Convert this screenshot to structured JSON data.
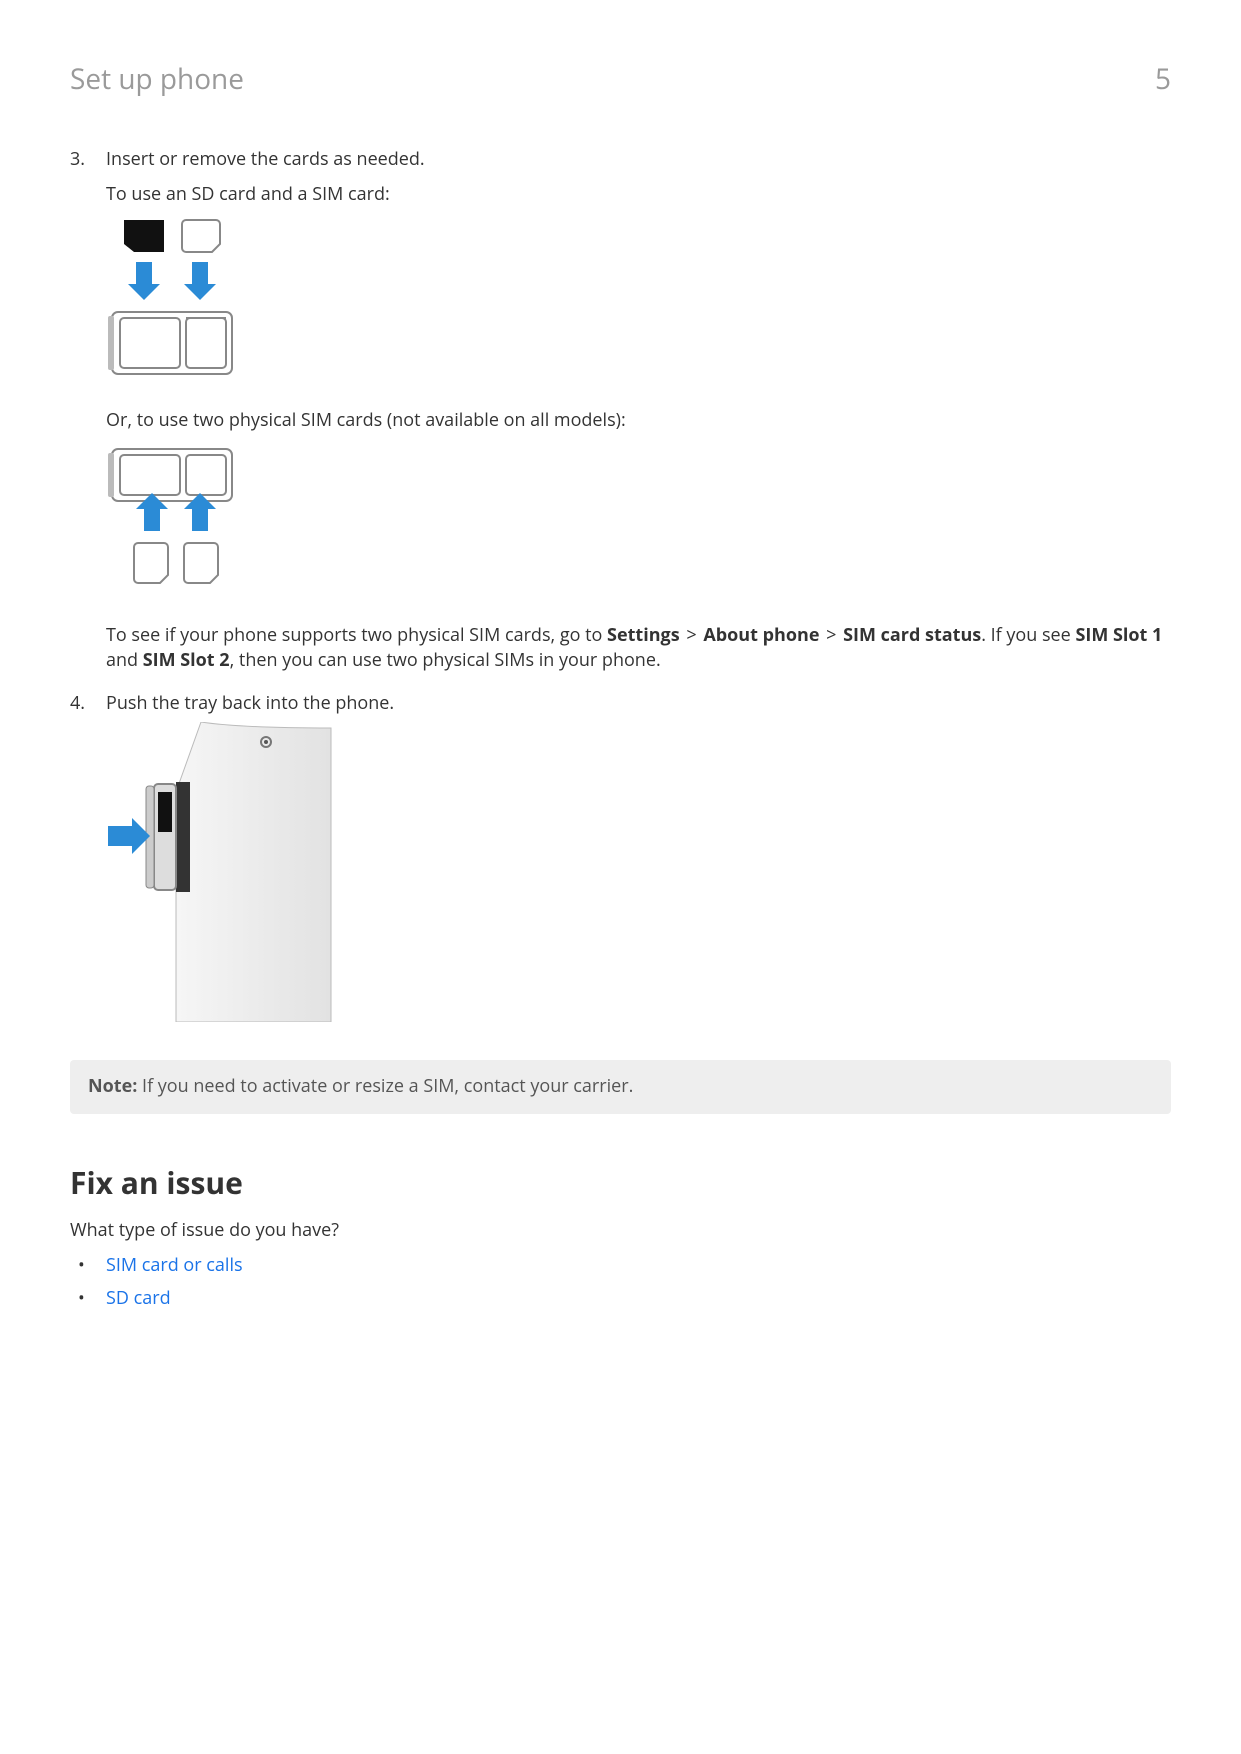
{
  "header": {
    "title": "Set up phone",
    "pageNumber": "5"
  },
  "steps": {
    "s3": {
      "num": "3.",
      "intro": "Insert or remove the cards as needed.",
      "useSdSim": "To use an SD card and a SIM card:",
      "useTwoSims": "Or, to use two physical SIM cards (not available on all models):",
      "support_pre": "To see if your phone supports two physical SIM cards, go to ",
      "support_settings": "Settings",
      "support_about": "About phone",
      "support_simstatus": "SIM card status",
      "support_mid1": ". If you see ",
      "support_slot1": "SIM Slot 1",
      "support_mid2": " and ",
      "support_slot2": "SIM Slot 2",
      "support_post": ", then you can use two physical SIMs in your phone.",
      "gt": ">"
    },
    "s4": {
      "num": "4.",
      "text": "Push the tray back into the phone."
    }
  },
  "note": {
    "label": "Note:",
    "text": " If you need to activate or resize a SIM, contact your carrier."
  },
  "fix": {
    "heading": "Fix an issue",
    "question": "What type of issue do you have?",
    "links": {
      "sim": "SIM card or calls",
      "sd": "SD card"
    }
  }
}
